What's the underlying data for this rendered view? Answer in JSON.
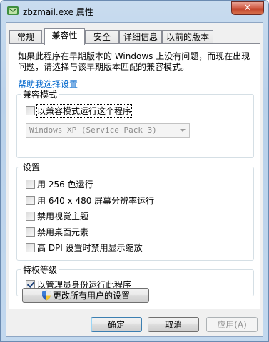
{
  "window": {
    "title": "zbzmail.exe 属性",
    "close_glyph": "✕"
  },
  "tabs": [
    {
      "label": "常规",
      "active": false
    },
    {
      "label": "兼容性",
      "active": true
    },
    {
      "label": "安全",
      "active": false
    },
    {
      "label": "详细信息",
      "active": false
    },
    {
      "label": "以前的版本",
      "active": false
    }
  ],
  "compat": {
    "intro": "如果此程序在早期版本的 Windows 上没有问题，而现在出现问题，请选择与该早期版本匹配的兼容模式。",
    "help_link": "帮助我选择设置",
    "mode_group": {
      "title": "兼容模式",
      "run_in_compat_label": "以兼容模式运行这个程序",
      "run_in_compat_checked": false,
      "os_select_value": "Windows XP (Service Pack 3)"
    },
    "settings_group": {
      "title": "设置",
      "items": [
        {
          "label": "用 256 色运行",
          "checked": false
        },
        {
          "label": "用 640 x 480 屏幕分辨率运行",
          "checked": false
        },
        {
          "label": "禁用视觉主题",
          "checked": false
        },
        {
          "label": "禁用桌面元素",
          "checked": false
        },
        {
          "label": "高 DPI 设置时禁用显示缩放",
          "checked": false
        }
      ]
    },
    "privilege_group": {
      "title": "特权等级",
      "run_as_admin_label": "以管理员身份运行此程序",
      "run_as_admin_checked": true
    },
    "all_users_button": "更改所有用户的设置"
  },
  "buttons": {
    "ok": "确定",
    "cancel": "取消",
    "apply": "应用(A)"
  },
  "colors": {
    "link": "#0066cc",
    "close_button": "#c2432a"
  }
}
